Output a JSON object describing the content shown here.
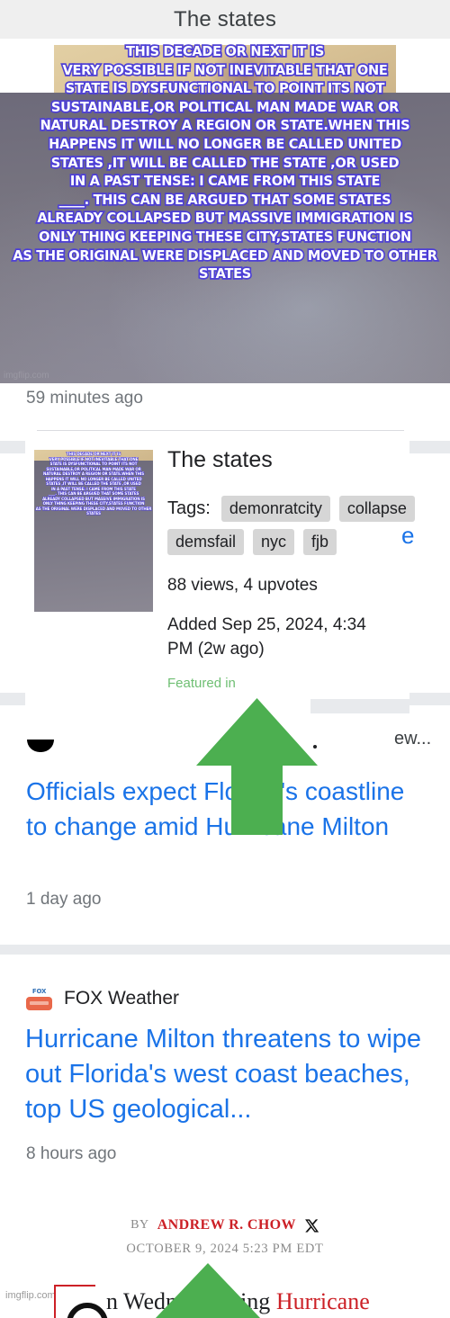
{
  "header": {
    "title": "The states"
  },
  "meme": {
    "text": "THIS DECADE OR NEXT IT IS\nVERY POSSIBLE IF NOT INEVITABLE THAT ONE\nSTATE IS DYSFUNCTIONAL TO POINT ITS NOT\nSUSTAINABLE,OR POLITICAL MAN MADE WAR OR\nNATURAL DESTROY A REGION OR STATE.WHEN THIS\nHAPPENS IT WILL NO LONGER BE CALLED UNITED\nSTATES ,IT WILL BE CALLED THE STATE ,OR USED\nIN A PAST TENSE: I CAME FROM THIS STATE\n____. THIS CAN BE ARGUED THAT SOME STATES\nALREADY COLLAPSED BUT MASSIVE IMMIGRATION IS\nONLY THING KEEPING THESE CITY,STATES FUNCTION\nAS THE ORIGINAL WERE DISPLACED AND MOVED TO OTHER STATES",
    "watermark": "imgflip.com",
    "feed_timestamp": "59 minutes ago"
  },
  "detail_card": {
    "title": "The states",
    "tags_label": "Tags:",
    "tags": [
      "demonratcity",
      "collapse",
      "demsfail",
      "nyc",
      "fjb"
    ],
    "stats": "88 views, 4 upvotes",
    "added": "Added Sep 25, 2024, 4:34 PM (2w ago)",
    "featured": "Featured in"
  },
  "background_bleed": {
    "blue_fragment": "e",
    "grey_fragment": "ew..."
  },
  "news_items": [
    {
      "headline": "Officials expect Florida's coastline to change amid Hurricane Milton",
      "timestamp": "1 day ago"
    },
    {
      "source": "FOX Weather",
      "source_logo_text": "FOX",
      "headline": "Hurricane Milton threatens to wipe out Florida's west coast beaches, top US geological...",
      "timestamp": "8 hours ago"
    }
  ],
  "byline": {
    "by_label": "BY",
    "author": "ANDREW R. CHOW",
    "social_icon": "x-twitter-icon",
    "date": "OCTOBER 9, 2024 5:23 PM EDT"
  },
  "bottom_article": {
    "watermark": "imgflip.com",
    "line_plain_a": "n Wedne",
    "line_plain_b": "ning",
    "line_red": "Hurricane"
  },
  "colors": {
    "link_blue": "#1a73e8",
    "meme_outline": "#4d3fd6",
    "arrow_green": "#4caf50",
    "byline_red": "#cc2026",
    "header_grey": "#efefef"
  }
}
